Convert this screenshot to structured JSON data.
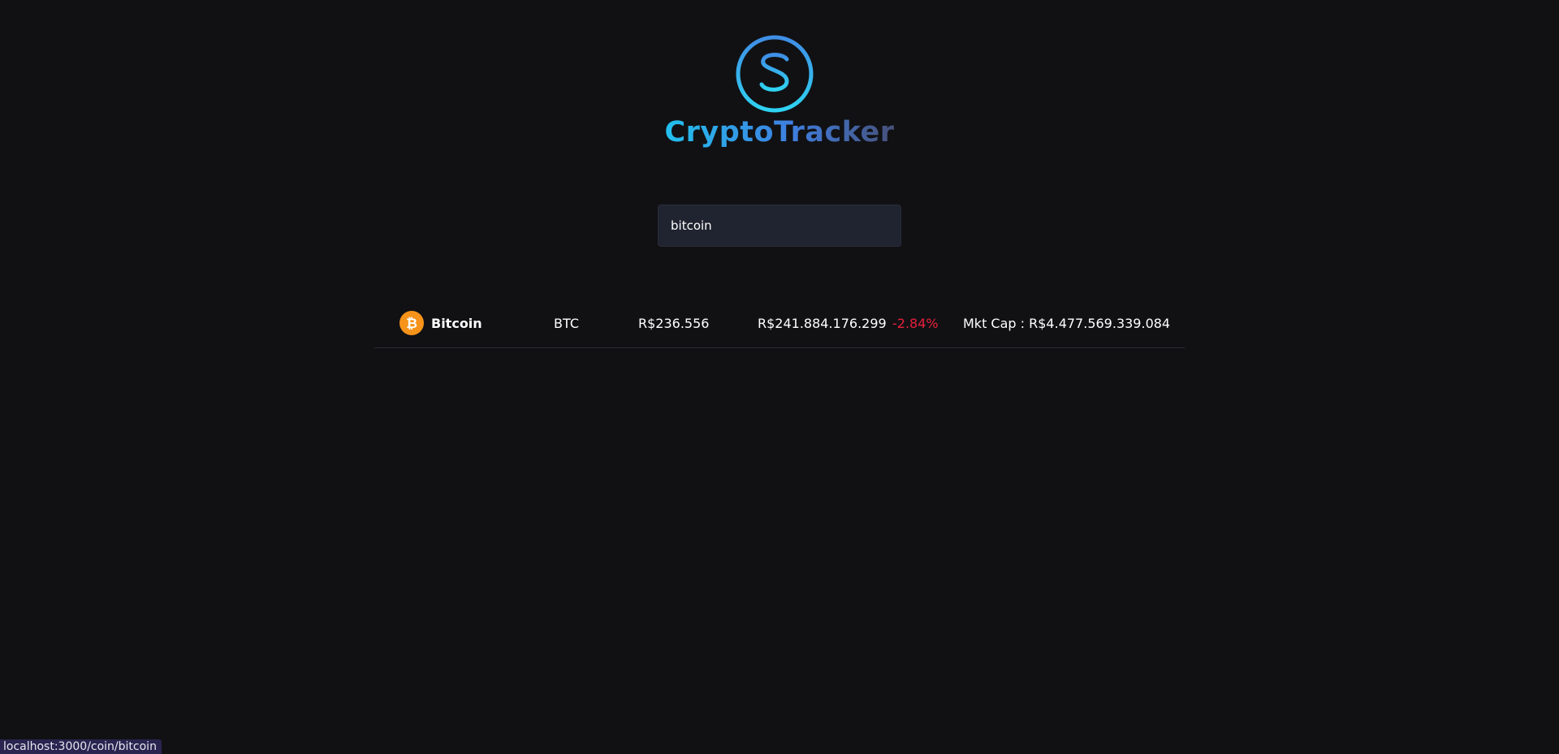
{
  "brand": {
    "name": "CryptoTracker",
    "icon": "dollar-circle-icon",
    "gradient": [
      "#22c1ee",
      "#3f7fe0",
      "#46507a"
    ]
  },
  "search": {
    "value": "bitcoin"
  },
  "coins": [
    {
      "icon": "bitcoin-icon",
      "name": "Bitcoin",
      "symbol": "BTC",
      "price": "R$236.556",
      "volume": "R$241.884.176.299",
      "change": "-2.84%",
      "change_color": "#ea1f3b",
      "market_cap": "Mkt Cap : R$4.477.569.339.084"
    }
  ],
  "status_bar": {
    "url": "localhost:3000/coin/bitcoin"
  }
}
